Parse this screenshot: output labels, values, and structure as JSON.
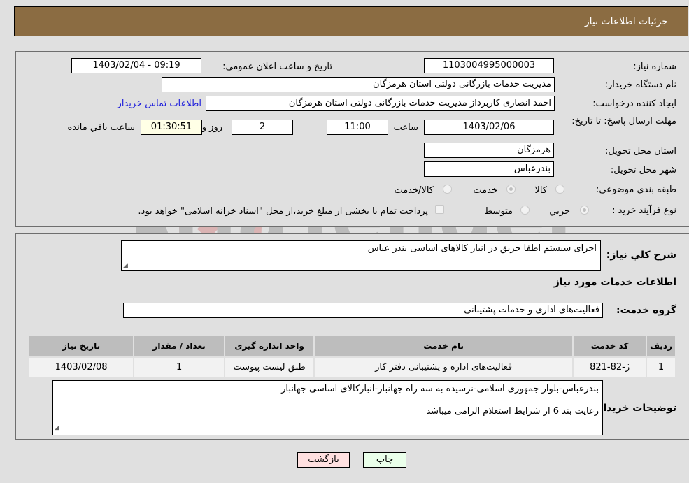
{
  "header": {
    "title": "جزئیات اطلاعات نیاز"
  },
  "details": {
    "need_number_label": "شماره نیاز:",
    "need_number": "1103004995000003",
    "announce_label": "تاریخ و ساعت اعلان عمومی:",
    "announce_value": "1403/02/04 - 09:19",
    "buyer_org_label": "نام دستگاه خریدار:",
    "buyer_org": "مدیریت خدمات بازرگانی دولتی استان هرمزگان",
    "requester_label": "ایجاد کننده درخواست:",
    "requester": "احمد انصاری کاربرداز مدیریت خدمات بازرگانی دولتی استان هرمزگان",
    "contact_link": "اطلاعات تماس خریدار",
    "deadline_label": "مهلت ارسال پاسخ: تا تاریخ:",
    "deadline_date": "1403/02/06",
    "time_label": "ساعت",
    "deadline_time": "11:00",
    "days_value": "2",
    "days_label": "روز و",
    "remaining_time": "01:30:51",
    "remaining_label": "ساعت باقي مانده",
    "province_label": "استان محل تحویل:",
    "province": "هرمزگان",
    "city_label": "شهر محل تحویل:",
    "city": "بندرعباس",
    "category_label": "طبقه بندی موضوعی:",
    "category_options": [
      {
        "label": "کالا",
        "checked": false
      },
      {
        "label": "خدمت",
        "checked": true
      },
      {
        "label": "کالا/خدمت",
        "checked": false
      }
    ],
    "process_label": "نوع فرآیند خرید :",
    "process_options": [
      {
        "label": "جزیي",
        "checked": true
      },
      {
        "label": "متوسط",
        "checked": false
      }
    ],
    "treasury_note": "پرداخت تمام یا بخشی از مبلغ خرید،از محل \"اسناد خزانه اسلامی\" خواهد بود.",
    "treasury_checked": false
  },
  "summary": {
    "description_label": "شرح کلي نیاز:",
    "description": "اجرای سیستم اطفا حریق در انبار کالاهای اساسی بندر عباس",
    "services_heading": "اطلاعات خدمات مورد نیاز",
    "service_group_label": "گروه خدمت:",
    "service_group": "فعالیت‌های اداری و خدمات پشتیبانی"
  },
  "table": {
    "headers": [
      "ردیف",
      "کد خدمت",
      "نام خدمت",
      "واحد اندازه گیری",
      "تعداد / مقدار",
      "تاریخ نیاز"
    ],
    "rows": [
      [
        "1",
        "ژ-82-821",
        "فعالیت‌های اداره و پشتیبانی دفتر کار",
        "طبق لیست پیوست",
        "1",
        "1403/02/08"
      ]
    ]
  },
  "buyer_notes": {
    "label": "توضیحات خریدار:",
    "line1": "بندرعباس-بلوار جمهوری اسلامی-نرسیده به سه راه جهانبار-انبارکالای اساسی جهانبار",
    "line2": "رعایت بند 6 از شرایط استعلام  الزامی میباشد"
  },
  "buttons": {
    "print": "چاپ",
    "back": "بازگشت"
  },
  "colors": {
    "header_bg": "#8b6c42",
    "back_bg": "#ffe0e0",
    "print_bg": "#eaffea",
    "link": "#1a1adb"
  }
}
